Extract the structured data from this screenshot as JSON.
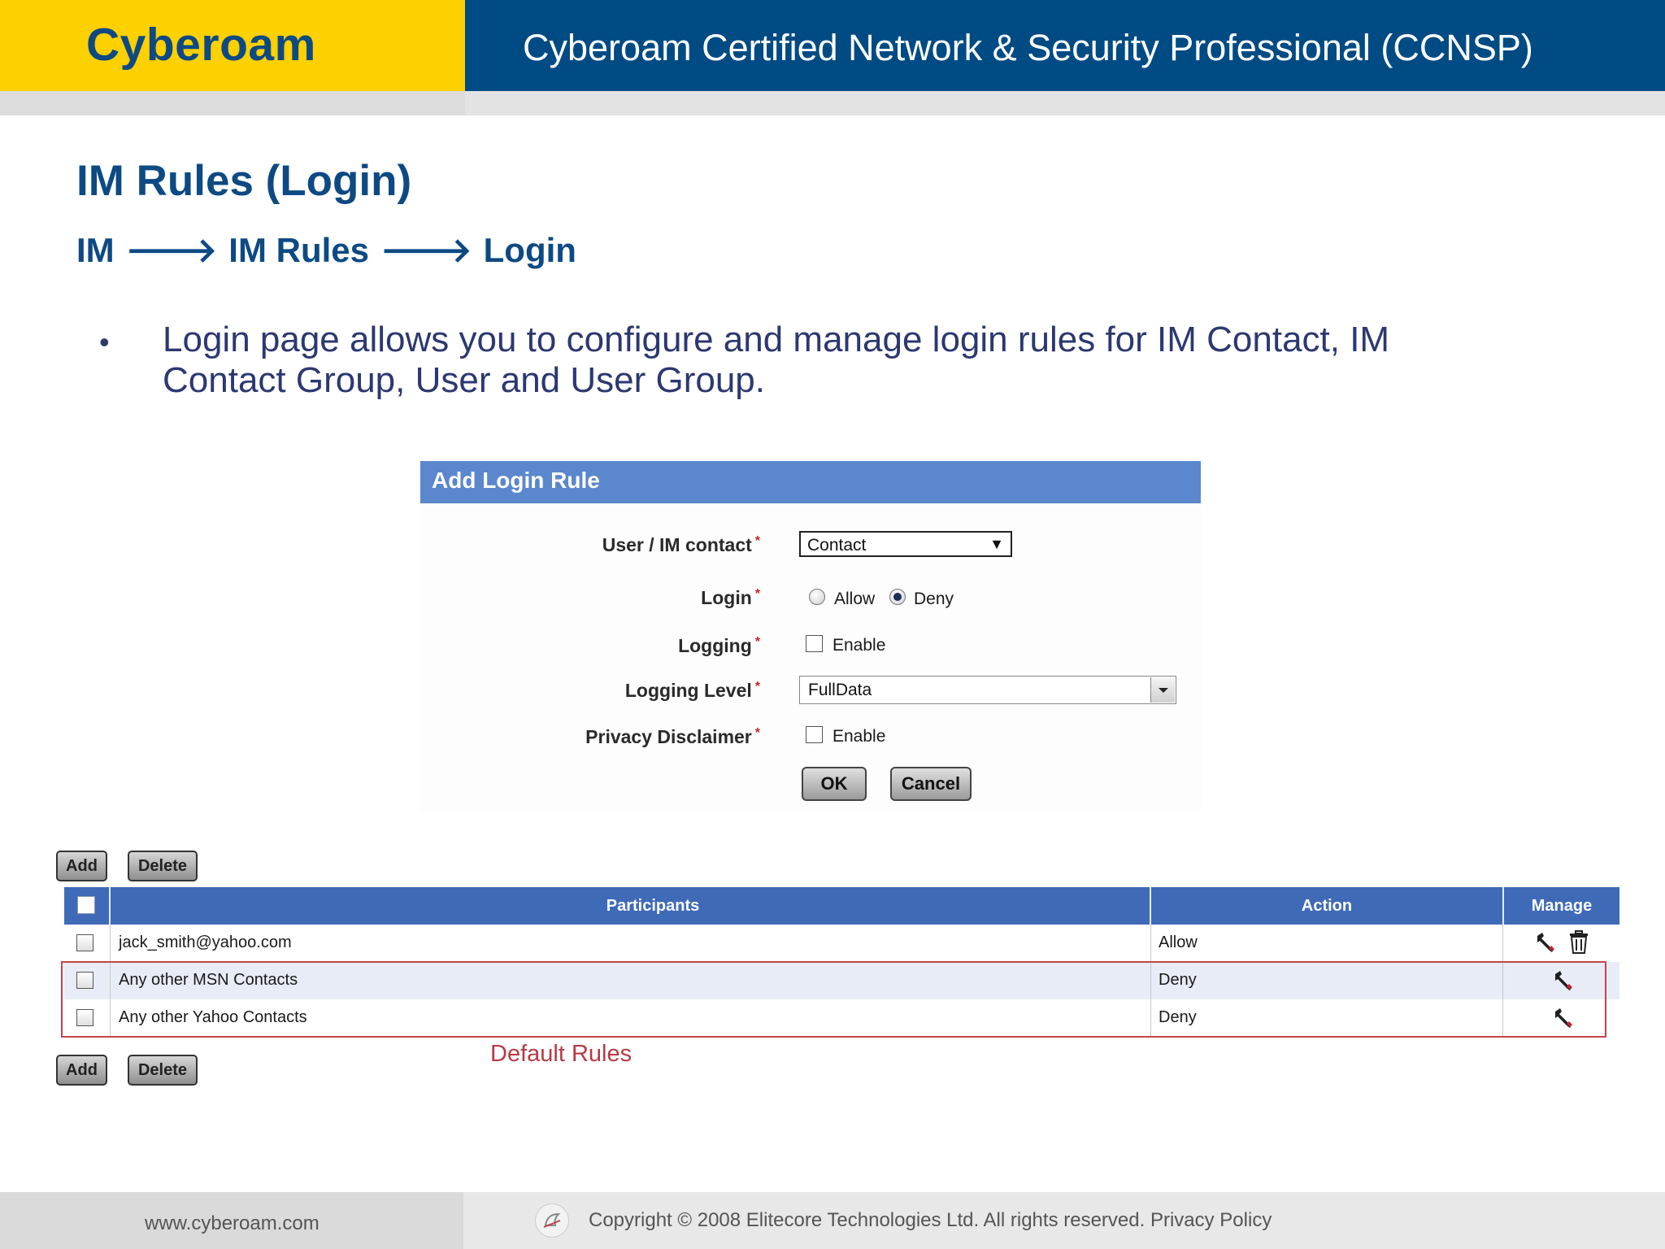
{
  "header": {
    "brand": "Cyberoam",
    "title": "Cyberoam Certified Network & Security Professional (CCNSP)"
  },
  "page": {
    "title": "IM Rules (Login)",
    "breadcrumb": [
      "IM",
      "IM Rules",
      "Login"
    ],
    "breadcrumb_separator": "🡒",
    "bullet": "Login page allows you to configure and manage login rules for IM Contact, IM Contact Group, User and User Group."
  },
  "form": {
    "title": "Add Login Rule",
    "required_mark": "*",
    "fields": {
      "user_im_contact": {
        "label": "User / IM contact",
        "value": "Contact"
      },
      "login": {
        "label": "Login",
        "options": [
          "Allow",
          "Deny"
        ],
        "selected": "Deny"
      },
      "logging": {
        "label": "Logging",
        "option": "Enable",
        "checked": false
      },
      "logging_level": {
        "label": "Logging Level",
        "value": "FullData"
      },
      "privacy_disclaimer": {
        "label": "Privacy Disclaimer",
        "option": "Enable",
        "checked": false
      }
    },
    "ok_label": "OK",
    "cancel_label": "Cancel"
  },
  "table_actions": {
    "add_label": "Add",
    "delete_label": "Delete"
  },
  "table": {
    "columns": [
      "Participants",
      "Action",
      "Manage"
    ],
    "rows": [
      {
        "participant": "jack_smith@yahoo.com",
        "action": "Allow",
        "manage": [
          "edit",
          "delete"
        ]
      },
      {
        "participant": "Any other MSN Contacts",
        "action": "Deny",
        "manage": [
          "edit"
        ]
      },
      {
        "participant": "Any other Yahoo Contacts",
        "action": "Deny",
        "manage": [
          "edit"
        ]
      }
    ],
    "default_rules_label": "Default Rules"
  },
  "footer": {
    "url": "www.cyberoam.com",
    "copyright": "Copyright © 2008 Elitecore Technologies Ltd. All rights reserved. Privacy Policy"
  },
  "colors": {
    "brand_yellow": "#fdd000",
    "brand_blue": "#004b84",
    "title_blue": "#0d4a84",
    "form_header": "#5b87cc",
    "table_header": "#3f6ab8",
    "highlight_red": "#c4444c"
  }
}
